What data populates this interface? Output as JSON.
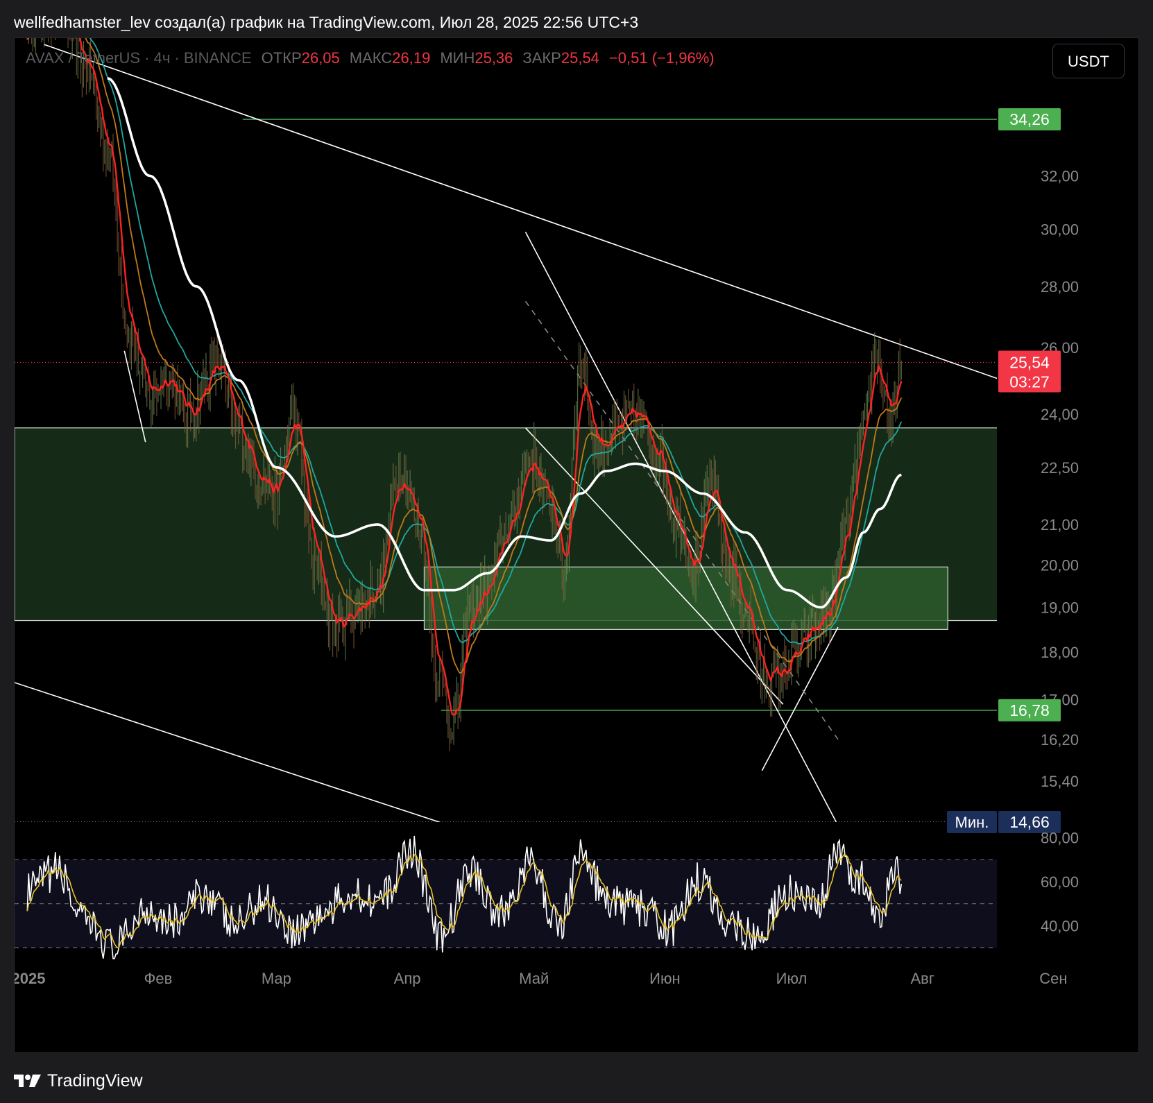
{
  "header": {
    "attribution": "wellfedhamster_lev создал(а) график на TradingView.com, Июл 28, 2025 22:56 UTC+3"
  },
  "legend": {
    "symbol": "AVAX / TetherUS · 4ч · BINANCE",
    "open_label": "ОТКР",
    "open_value": "26,05",
    "high_label": "МАКС",
    "high_value": "26,19",
    "low_label": "МИН",
    "low_value": "25,36",
    "close_label": "ЗАКР",
    "close_value": "25,54",
    "change": "−0,51 (−1,96%)"
  },
  "currency_button": "USDT",
  "colors": {
    "background": "#000000",
    "down": "#f23645",
    "up_level": "#4caf50",
    "zone": "#18301a",
    "zone_inner": "#2c5a2c",
    "ema_fast": "#ff2222",
    "ema_mid": "#c07a1a",
    "ema_slow": "#1fa8a0",
    "ma_long": "#ffffff",
    "rsi": "#ffffff",
    "rsi_ma": "#e6c229",
    "min_badge": "#1c2e5a"
  },
  "chart_data": {
    "type": "line",
    "title": "AVAX / TetherUS · 4ч · BINANCE",
    "xlabel": "",
    "ylabel": "",
    "x_ticks": [
      "2025",
      "Фев",
      "Мар",
      "Апр",
      "Май",
      "Июн",
      "Июл",
      "Авг",
      "Сен"
    ],
    "x_tick_dates": [
      "2025-01-01",
      "2025-02-01",
      "2025-03-01",
      "2025-04-01",
      "2025-05-01",
      "2025-06-01",
      "2025-07-01",
      "2025-08-01",
      "2025-09-01"
    ],
    "xlim": [
      "2024-12-29",
      "2025-09-08"
    ],
    "y_ticks": [
      {
        "value": 32,
        "label": "32,00"
      },
      {
        "value": 30,
        "label": "30,00"
      },
      {
        "value": 28,
        "label": "28,00"
      },
      {
        "value": 26,
        "label": "26,00"
      },
      {
        "value": 24,
        "label": "24,00"
      },
      {
        "value": 22.5,
        "label": "22,50"
      },
      {
        "value": 21,
        "label": "21,00"
      },
      {
        "value": 20,
        "label": "20,00"
      },
      {
        "value": 19,
        "label": "19,00"
      },
      {
        "value": 18,
        "label": "18,00"
      },
      {
        "value": 17,
        "label": "17,00"
      },
      {
        "value": 16.2,
        "label": "16,20"
      },
      {
        "value": 15.4,
        "label": "15,40"
      }
    ],
    "price_labels": [
      {
        "value": 34.26,
        "label": "34,26",
        "kind": "level"
      },
      {
        "value": 25.54,
        "label": "25,54",
        "sub": "03:27",
        "kind": "last"
      },
      {
        "value": 16.78,
        "label": "16,78",
        "kind": "level"
      },
      {
        "value": 14.66,
        "label": "14,66",
        "prefix": "Мин.",
        "kind": "min"
      }
    ],
    "horizontal_levels": [
      {
        "value": 34.26,
        "from": "2025-02-21",
        "style": "solid-green"
      },
      {
        "value": 16.78,
        "from": "2025-04-09",
        "style": "solid-green"
      },
      {
        "value": 25.54,
        "from": "2024-12-29",
        "style": "dotted-red"
      },
      {
        "value": 14.66,
        "from": "2024-12-29",
        "style": "dotted-white"
      }
    ],
    "zones": [
      {
        "from": "2024-12-29",
        "to": "2025-08-31",
        "top": 23.6,
        "bottom": 18.7
      },
      {
        "from": "2025-04-05",
        "to": "2025-08-07",
        "top": 19.95,
        "bottom": 18.5
      }
    ],
    "trend_lines": [
      {
        "from": [
          "2025-01-05",
          37.5
        ],
        "to": [
          "2025-08-30",
          24.55
        ]
      },
      {
        "from": [
          "2024-12-29",
          17.35
        ],
        "to": [
          "2025-04-11",
          14.6
        ]
      },
      {
        "from": [
          "2025-04-29",
          29.9
        ],
        "to": [
          "2025-07-12",
          14.6
        ]
      },
      {
        "from": [
          "2025-04-29",
          23.6
        ],
        "to": [
          "2025-06-29",
          16.9
        ]
      },
      {
        "from": [
          "2025-06-24",
          15.6
        ],
        "to": [
          "2025-07-12",
          18.55
        ]
      },
      {
        "from": [
          "2025-01-24",
          25.9
        ],
        "to": [
          "2025-01-29",
          23.2
        ]
      }
    ],
    "dashed_lines": [
      {
        "from": [
          "2025-04-29",
          27.5
        ],
        "to": [
          "2025-07-12",
          16.2
        ]
      }
    ],
    "series": [
      {
        "name": "Close",
        "x": [
          "2025-01-01",
          "2025-01-08",
          "2025-01-15",
          "2025-01-20",
          "2025-01-25",
          "2025-01-30",
          "2025-02-03",
          "2025-02-08",
          "2025-02-15",
          "2025-02-20",
          "2025-02-25",
          "2025-03-01",
          "2025-03-05",
          "2025-03-10",
          "2025-03-15",
          "2025-03-20",
          "2025-03-25",
          "2025-03-30",
          "2025-04-04",
          "2025-04-08",
          "2025-04-12",
          "2025-04-16",
          "2025-04-20",
          "2025-04-25",
          "2025-04-30",
          "2025-05-05",
          "2025-05-08",
          "2025-05-12",
          "2025-05-16",
          "2025-05-20",
          "2025-05-25",
          "2025-05-30",
          "2025-06-04",
          "2025-06-08",
          "2025-06-12",
          "2025-06-16",
          "2025-06-20",
          "2025-06-24",
          "2025-06-28",
          "2025-07-02",
          "2025-07-06",
          "2025-07-10",
          "2025-07-14",
          "2025-07-18",
          "2025-07-21",
          "2025-07-23",
          "2025-07-25",
          "2025-07-27"
        ],
        "values": [
          38.5,
          39.2,
          36.6,
          33.0,
          26.5,
          24.5,
          25.2,
          24.0,
          25.5,
          23.5,
          22.3,
          21.8,
          24.0,
          20.0,
          18.5,
          19.0,
          19.5,
          22.5,
          21.0,
          17.5,
          16.5,
          19.0,
          19.5,
          21.0,
          22.8,
          21.5,
          19.8,
          25.5,
          23.0,
          23.5,
          24.0,
          23.0,
          21.0,
          20.0,
          22.0,
          20.0,
          19.0,
          17.5,
          17.5,
          18.0,
          18.5,
          19.0,
          21.0,
          23.5,
          26.0,
          24.5,
          23.8,
          25.54
        ]
      },
      {
        "name": "MA",
        "x": [
          "2025-01-20",
          "2025-01-30",
          "2025-02-10",
          "2025-02-20",
          "2025-03-01",
          "2025-03-15",
          "2025-03-25",
          "2025-04-05",
          "2025-04-12",
          "2025-04-20",
          "2025-04-28",
          "2025-05-05",
          "2025-05-12",
          "2025-05-18",
          "2025-05-25",
          "2025-06-01",
          "2025-06-10",
          "2025-06-20",
          "2025-06-30",
          "2025-07-08",
          "2025-07-14",
          "2025-07-18",
          "2025-07-22",
          "2025-07-27"
        ],
        "values": [
          36.0,
          32.0,
          28.0,
          25.0,
          22.5,
          20.7,
          21.0,
          19.4,
          19.4,
          19.8,
          20.7,
          20.6,
          21.8,
          22.4,
          22.6,
          22.4,
          21.8,
          20.8,
          19.4,
          19.0,
          19.7,
          20.8,
          21.4,
          22.3
        ]
      }
    ],
    "rsi": {
      "y_ticks": [
        {
          "value": 80,
          "label": "80,00"
        },
        {
          "value": 60,
          "label": "60,00"
        },
        {
          "value": 40,
          "label": "40,00"
        }
      ],
      "bands": [
        70,
        50,
        30
      ],
      "ylim": [
        24,
        84
      ],
      "x": [
        "2025-01-01",
        "2025-01-08",
        "2025-01-15",
        "2025-01-22",
        "2025-01-29",
        "2025-02-05",
        "2025-02-12",
        "2025-02-19",
        "2025-02-26",
        "2025-03-05",
        "2025-03-12",
        "2025-03-19",
        "2025-03-26",
        "2025-04-02",
        "2025-04-09",
        "2025-04-16",
        "2025-04-23",
        "2025-04-30",
        "2025-05-07",
        "2025-05-12",
        "2025-05-19",
        "2025-05-26",
        "2025-06-02",
        "2025-06-09",
        "2025-06-16",
        "2025-06-23",
        "2025-06-30",
        "2025-07-07",
        "2025-07-12",
        "2025-07-17",
        "2025-07-22",
        "2025-07-25",
        "2025-07-27"
      ],
      "values": [
        55,
        65,
        40,
        30,
        48,
        42,
        55,
        40,
        52,
        38,
        45,
        55,
        52,
        75,
        34,
        65,
        45,
        68,
        40,
        72,
        50,
        48,
        38,
        60,
        42,
        35,
        55,
        48,
        72,
        62,
        40,
        68,
        60
      ]
    }
  },
  "footer": {
    "brand": "TradingView"
  }
}
